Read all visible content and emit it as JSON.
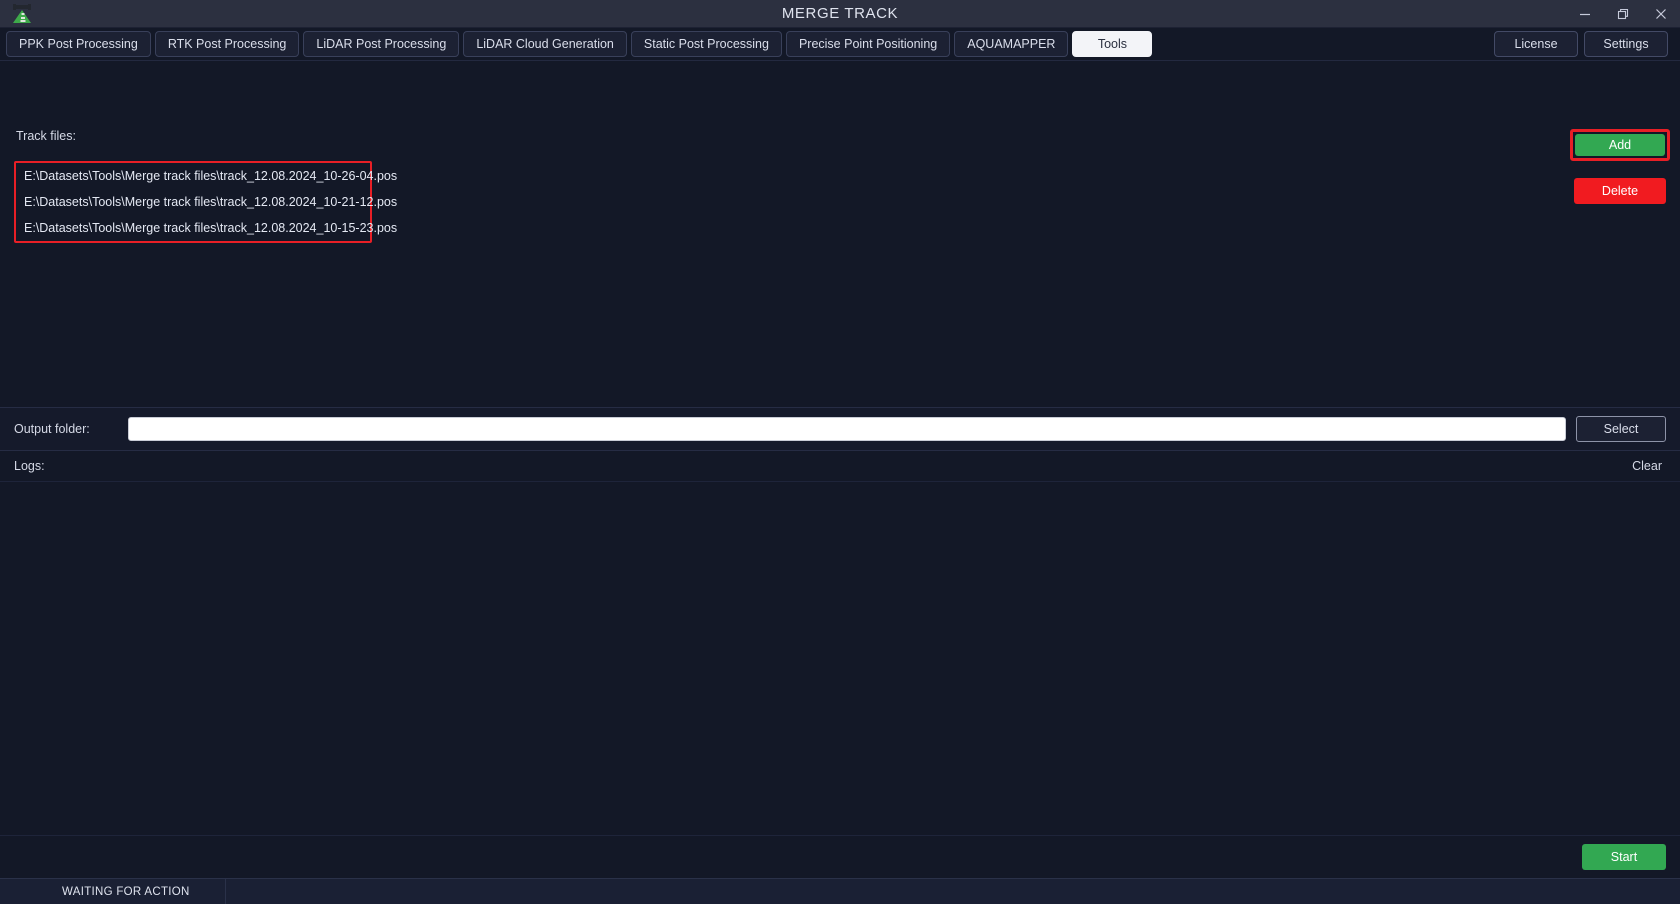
{
  "window": {
    "title": "MERGE TRACK",
    "app_icon": "road-track-icon",
    "controls": {
      "minimize": "minimize-icon",
      "restore": "restore-icon",
      "close": "close-icon"
    }
  },
  "tabs": [
    {
      "label": "PPK Post Processing",
      "active": false
    },
    {
      "label": "RTK Post Processing",
      "active": false
    },
    {
      "label": "LiDAR Post Processing",
      "active": false
    },
    {
      "label": "LiDAR Cloud Generation",
      "active": false
    },
    {
      "label": "Static Post Processing",
      "active": false
    },
    {
      "label": "Precise Point Positioning",
      "active": false
    },
    {
      "label": "AQUAMAPPER",
      "active": false
    },
    {
      "label": "Tools",
      "active": true
    }
  ],
  "tabs_right": [
    {
      "label": "License"
    },
    {
      "label": "Settings"
    }
  ],
  "main": {
    "track_files_label": "Track files:",
    "track_files": [
      "E:\\Datasets\\Tools\\Merge track files\\track_12.08.2024_10-26-04.pos",
      "E:\\Datasets\\Tools\\Merge track files\\track_12.08.2024_10-21-12.pos",
      "E:\\Datasets\\Tools\\Merge track files\\track_12.08.2024_10-15-23.pos"
    ],
    "add_label": "Add",
    "delete_label": "Delete"
  },
  "output": {
    "label": "Output folder:",
    "value": "",
    "placeholder": "",
    "select_label": "Select"
  },
  "logs": {
    "label": "Logs:",
    "clear_label": "Clear",
    "lines": []
  },
  "actions": {
    "start_label": "Start"
  },
  "statusbar": {
    "status": "WAITING FOR ACTION",
    "secondary": ""
  },
  "colors": {
    "accent_green": "#32a852",
    "danger_red": "#f11b20",
    "highlight_red": "#e81f26",
    "window_bg": "#131827",
    "titlebar_bg": "#2c3040",
    "tab_bg": "#1c2133",
    "tab_active_bg": "#f3f4f8"
  }
}
